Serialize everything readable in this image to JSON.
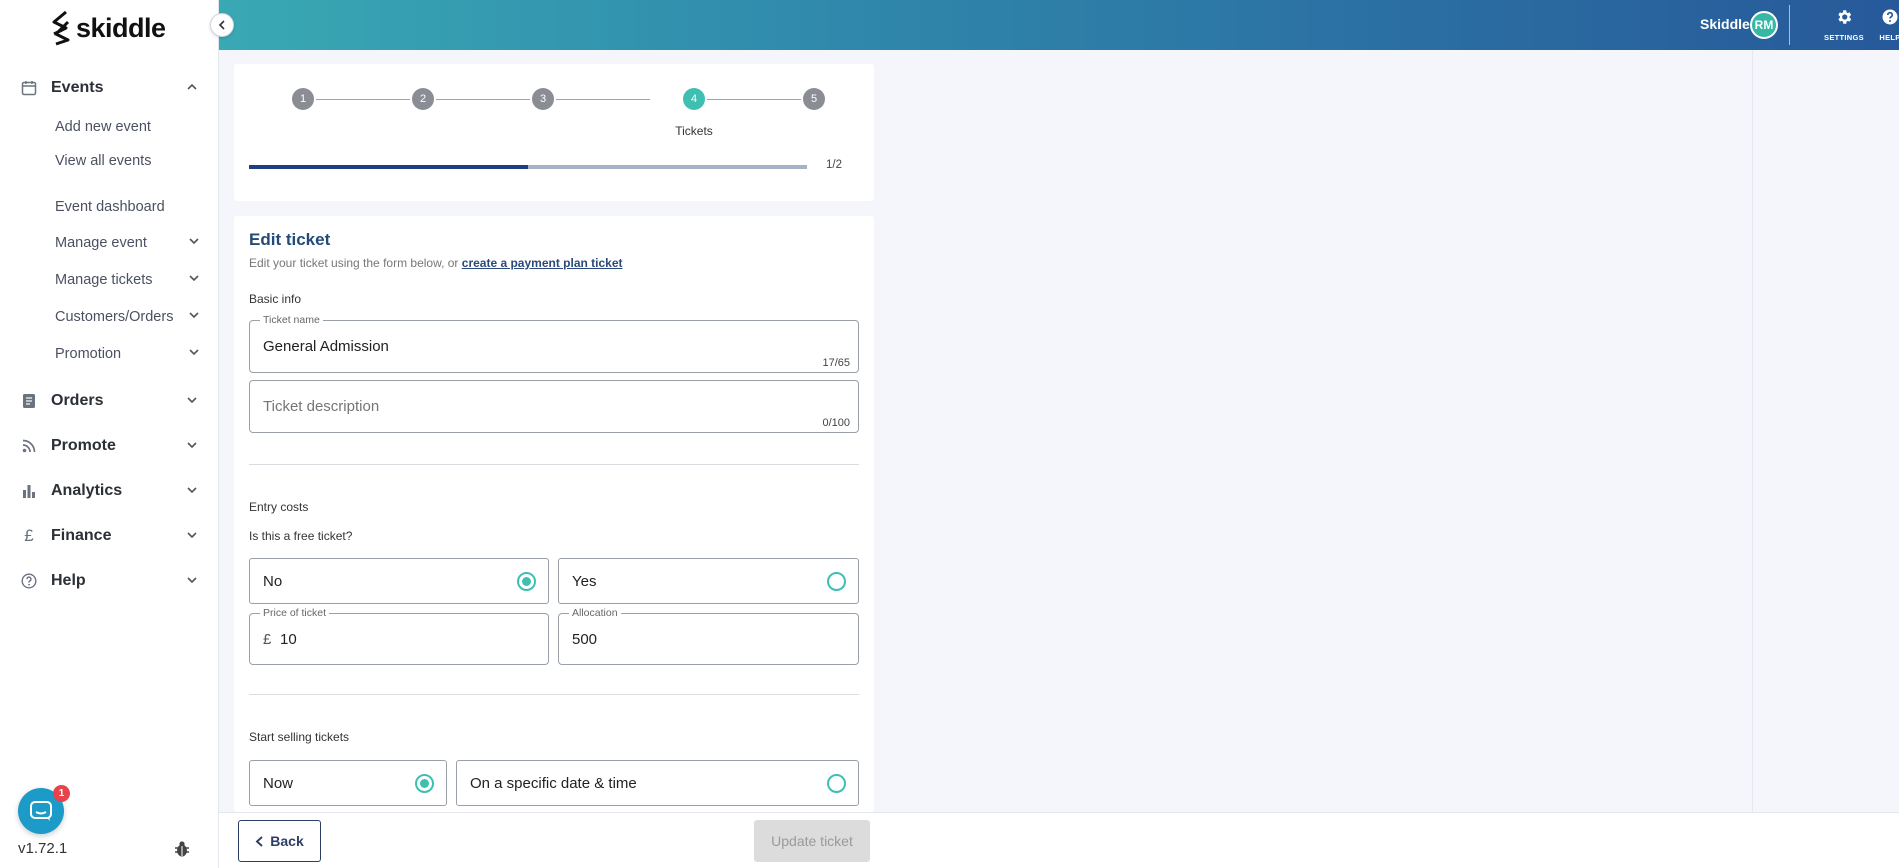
{
  "brand": {
    "logo_text": "skiddle"
  },
  "header": {
    "account_name": "Skiddle",
    "avatar_initials": "RM",
    "settings_label": "SETTINGS",
    "help_label": "HELP"
  },
  "sidebar": {
    "events": {
      "label": "Events"
    },
    "events_items": [
      {
        "label": "Add new event"
      },
      {
        "label": "View all events"
      },
      {
        "label": "Event dashboard"
      },
      {
        "label": "Manage event"
      },
      {
        "label": "Manage tickets"
      },
      {
        "label": "Customers/Orders"
      },
      {
        "label": "Promotion"
      }
    ],
    "sections": [
      {
        "label": "Orders"
      },
      {
        "label": "Promote"
      },
      {
        "label": "Analytics"
      },
      {
        "label": "Finance"
      },
      {
        "label": "Help"
      }
    ],
    "version": "v1.72.1",
    "chat_badge": "1"
  },
  "stepper": {
    "steps": [
      "1",
      "2",
      "3",
      "4",
      "5"
    ],
    "active_step": 4,
    "active_caption": "Tickets",
    "progress_label": "1/2",
    "progress": 0.5
  },
  "form": {
    "title": "Edit ticket",
    "desc_prefix": "Edit your ticket using the form below, or ",
    "desc_link": "create a payment plan ticket",
    "basic_info_label": "Basic info",
    "ticket_name": {
      "legend": "Ticket name",
      "value": "General Admission",
      "counter": "17/65"
    },
    "ticket_description": {
      "placeholder": "Ticket description",
      "counter": "0/100"
    },
    "entry_costs_label": "Entry costs",
    "free_question": "Is this a free ticket?",
    "free_no": "No",
    "free_yes": "Yes",
    "price": {
      "legend": "Price of ticket",
      "currency": "£",
      "value": "10"
    },
    "allocation": {
      "legend": "Allocation",
      "value": "500"
    },
    "start_selling_label": "Start selling tickets",
    "sell_now": "Now",
    "sell_specific": "On a specific date & time"
  },
  "footer": {
    "back_label": "Back",
    "update_label": "Update ticket"
  },
  "colors": {
    "accent": "#3fbfb2",
    "navy": "#1d3f7d",
    "header_start": "#39a9b4",
    "header_end": "#27599a"
  }
}
